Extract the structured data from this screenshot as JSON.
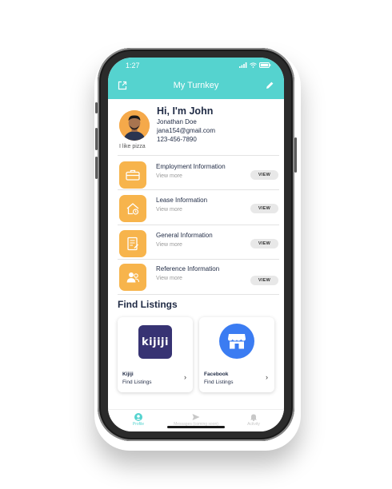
{
  "status": {
    "time": "1:27"
  },
  "header": {
    "title": "My Turnkey"
  },
  "profile": {
    "greeting": "Hi, I'm John",
    "name": "Jonathan Doe",
    "email": "jana154@gmail.com",
    "phone": "123-456-7890",
    "bio": "I like pizza"
  },
  "info_rows": [
    {
      "title": "Employment Information",
      "subtitle": "View more",
      "button": "VIEW",
      "icon": "briefcase-icon"
    },
    {
      "title": "Lease Information",
      "subtitle": "View more",
      "button": "VIEW",
      "icon": "house-icon"
    },
    {
      "title": "General Information",
      "subtitle": "View more",
      "button": "VIEW",
      "icon": "document-icon"
    },
    {
      "title": "Reference Information",
      "subtitle": "View more",
      "button": "VIEW",
      "icon": "people-icon"
    }
  ],
  "listings": {
    "title": "Find Listings",
    "cards": [
      {
        "name": "Kijiji",
        "subtitle": "Find Listings",
        "logo_text": "kijiji"
      },
      {
        "name": "Facebook",
        "subtitle": "Find Listings"
      }
    ]
  },
  "tabbar": {
    "tabs": [
      {
        "label": "Profile",
        "active": true
      },
      {
        "label": "Messages (coming soon)",
        "active": false
      },
      {
        "label": "Activity",
        "active": false
      }
    ]
  },
  "colors": {
    "accent": "#55d3cf",
    "icon_bg": "#f7b44c",
    "text": "#1f2a44",
    "kijiji_bg": "#373373",
    "facebook_blue": "#3b7cf2"
  }
}
